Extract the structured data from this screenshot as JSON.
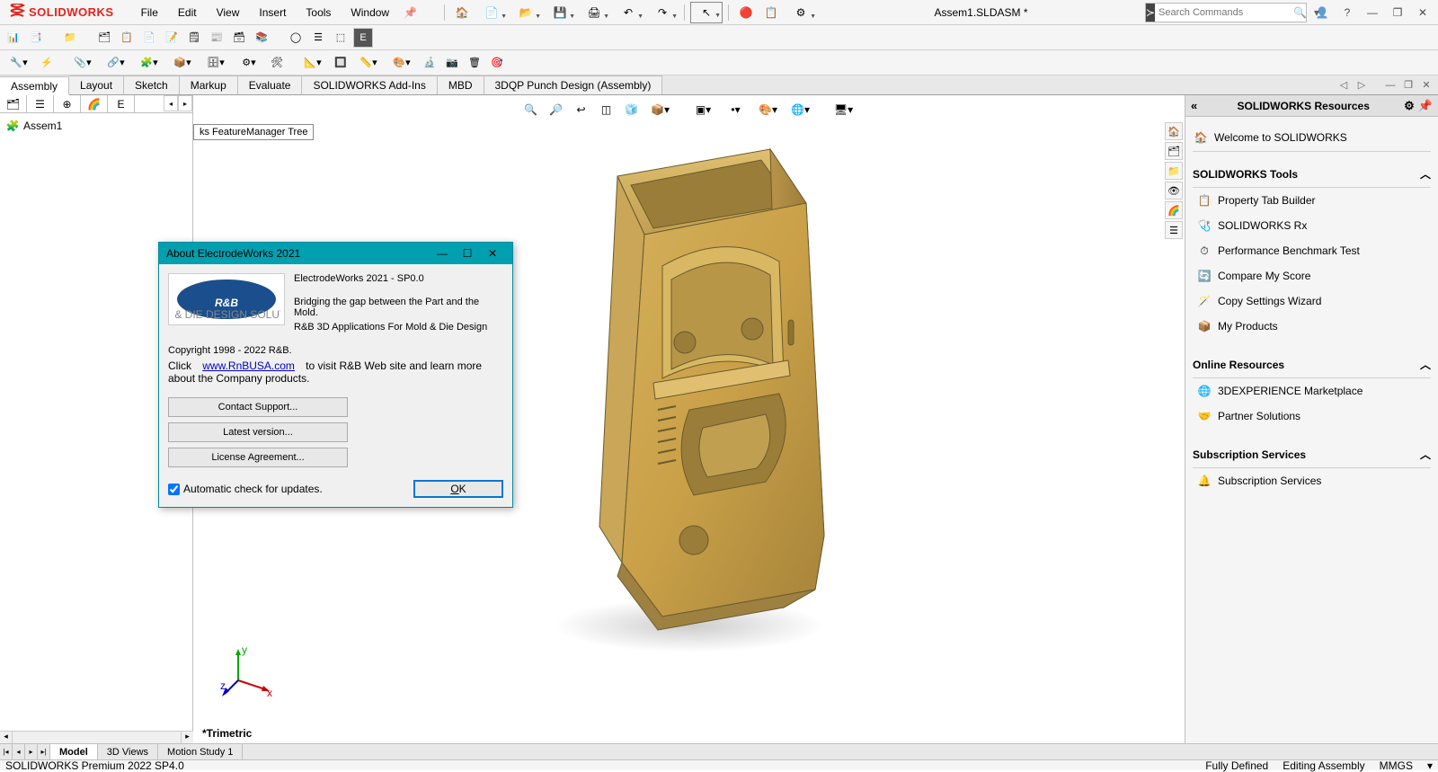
{
  "app": {
    "logo_text": "SOLIDWORKS",
    "document": "Assem1.SLDASM *",
    "search_placeholder": "Search Commands"
  },
  "menus": [
    "File",
    "Edit",
    "View",
    "Insert",
    "Tools",
    "Window"
  ],
  "cmd_tabs": [
    "Assembly",
    "Layout",
    "Sketch",
    "Markup",
    "Evaluate",
    "SOLIDWORKS Add-Ins",
    "MBD",
    "3DQP Punch Design (Assembly)"
  ],
  "tree": {
    "root": "Assem1",
    "breadcrumb_label": "ks FeatureManager Tree"
  },
  "view_label": "*Trimetric",
  "task_pane": {
    "title": "SOLIDWORKS Resources",
    "welcome": "Welcome to SOLIDWORKS",
    "sections": [
      {
        "title": "SOLIDWORKS Tools",
        "items": [
          "Property Tab Builder",
          "SOLIDWORKS Rx",
          "Performance Benchmark Test",
          "Compare My Score",
          "Copy Settings Wizard",
          "My Products"
        ]
      },
      {
        "title": "Online Resources",
        "items": [
          "3DEXPERIENCE Marketplace",
          "Partner Solutions"
        ]
      },
      {
        "title": "Subscription Services",
        "items": [
          "Subscription Services"
        ]
      }
    ]
  },
  "bottom_tabs": [
    "Model",
    "3D Views",
    "Motion Study 1"
  ],
  "status": {
    "left": "SOLIDWORKS Premium 2022 SP4.0",
    "defined": "Fully Defined",
    "mode": "Editing Assembly",
    "units": "MMGS"
  },
  "dialog": {
    "title": "About ElectrodeWorks 2021",
    "product": "ElectrodeWorks 2021 - SP0.0",
    "tagline1": "Bridging the gap between the Part and the Mold.",
    "tagline2": "R&B 3D Applications For Mold & Die Design",
    "copyright": "Copyright 1998 - 2022 R&B.",
    "click": "Click",
    "link": "www.RnBUSA.com",
    "link_after": "to visit R&B Web site and learn more about the Company products.",
    "btn_support": "Contact Support...",
    "btn_latest": "Latest version...",
    "btn_license": "License Agreement...",
    "check_label": "Automatic check for updates.",
    "ok": "OK"
  }
}
